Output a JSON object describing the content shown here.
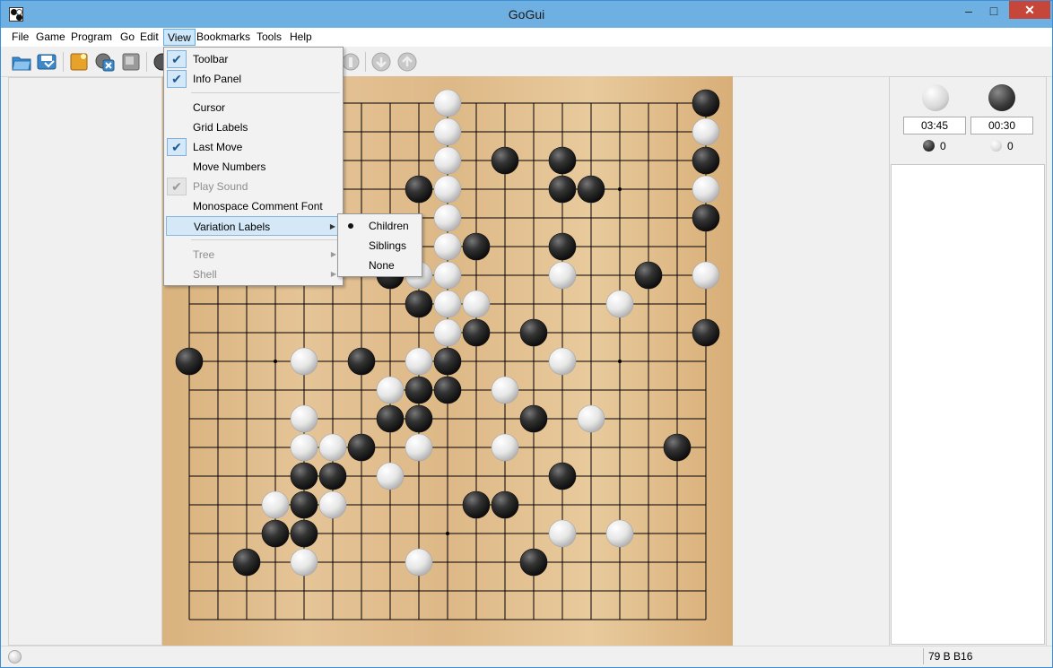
{
  "window": {
    "title": "GoGui"
  },
  "titlebar_buttons": {
    "minimize": "–",
    "maximize": "□",
    "close": "✕"
  },
  "menubar": [
    "File",
    "Game",
    "Program",
    "Go",
    "Edit",
    "View",
    "Bookmarks",
    "Tools",
    "Help"
  ],
  "view_menu": {
    "items": [
      {
        "label": "Toolbar",
        "checked": true
      },
      {
        "label": "Info Panel",
        "checked": true
      },
      {
        "label": "Cursor",
        "checked": false
      },
      {
        "label": "Grid Labels",
        "checked": false
      },
      {
        "label": "Last Move",
        "checked": true
      },
      {
        "label": "Move Numbers",
        "checked": false
      },
      {
        "label": "Play Sound",
        "checked": true,
        "disabled": true
      },
      {
        "label": "Monospace Comment Font",
        "checked": false
      },
      {
        "label": "Variation Labels",
        "submenu": true,
        "highlighted": true
      },
      {
        "label": "Tree",
        "submenu": true,
        "disabled": true
      },
      {
        "label": "Shell",
        "submenu": true,
        "disabled": true
      }
    ]
  },
  "variation_labels_submenu": {
    "items": [
      {
        "label": "Children",
        "selected": true
      },
      {
        "label": "Siblings",
        "selected": false
      },
      {
        "label": "None",
        "selected": false
      }
    ]
  },
  "toolbar": {
    "icons": [
      "open-icon",
      "save-icon",
      "new-game-icon",
      "close-game-icon",
      "attach-program-icon",
      "play-icon",
      "info-icon",
      "back-icon",
      "forward-icon"
    ]
  },
  "board": {
    "size": 19,
    "hoshi": [
      [
        3,
        3
      ],
      [
        3,
        9
      ],
      [
        3,
        15
      ],
      [
        9,
        3
      ],
      [
        9,
        9
      ],
      [
        9,
        15
      ],
      [
        15,
        3
      ],
      [
        15,
        9
      ],
      [
        15,
        15
      ]
    ],
    "black": [
      [
        18,
        0
      ],
      [
        18,
        2
      ],
      [
        11,
        2
      ],
      [
        13,
        2
      ],
      [
        8,
        3
      ],
      [
        13,
        3
      ],
      [
        14,
        3
      ],
      [
        18,
        4
      ],
      [
        10,
        5
      ],
      [
        13,
        5
      ],
      [
        7,
        6
      ],
      [
        16,
        6
      ],
      [
        8,
        7
      ],
      [
        10,
        8
      ],
      [
        12,
        8
      ],
      [
        18,
        8
      ],
      [
        0,
        9
      ],
      [
        6,
        9
      ],
      [
        9,
        9
      ],
      [
        8,
        10
      ],
      [
        9,
        10
      ],
      [
        7,
        11
      ],
      [
        8,
        11
      ],
      [
        12,
        11
      ],
      [
        6,
        12
      ],
      [
        17,
        12
      ],
      [
        4,
        13
      ],
      [
        5,
        13
      ],
      [
        13,
        13
      ],
      [
        4,
        14
      ],
      [
        10,
        14
      ],
      [
        11,
        14
      ],
      [
        3,
        15
      ],
      [
        4,
        15
      ],
      [
        2,
        16
      ],
      [
        12,
        16
      ]
    ],
    "white": [
      [
        9,
        0
      ],
      [
        9,
        1
      ],
      [
        18,
        1
      ],
      [
        9,
        2
      ],
      [
        9,
        3
      ],
      [
        18,
        3
      ],
      [
        9,
        4
      ],
      [
        9,
        5
      ],
      [
        8,
        6
      ],
      [
        9,
        6
      ],
      [
        13,
        6
      ],
      [
        18,
        6
      ],
      [
        9,
        7
      ],
      [
        10,
        7
      ],
      [
        15,
        7
      ],
      [
        9,
        8
      ],
      [
        4,
        9
      ],
      [
        8,
        9
      ],
      [
        13,
        9
      ],
      [
        7,
        10
      ],
      [
        11,
        10
      ],
      [
        4,
        11
      ],
      [
        14,
        11
      ],
      [
        4,
        12
      ],
      [
        5,
        12
      ],
      [
        8,
        12
      ],
      [
        11,
        12
      ],
      [
        7,
        13
      ],
      [
        3,
        14
      ],
      [
        5,
        14
      ],
      [
        13,
        15
      ],
      [
        15,
        15
      ],
      [
        4,
        16
      ],
      [
        8,
        16
      ]
    ]
  },
  "info_panel": {
    "white_time": "03:45",
    "black_time": "00:30",
    "black_captures": "0",
    "white_captures": "0"
  },
  "statusbar": {
    "move_text": "79 B B16"
  }
}
